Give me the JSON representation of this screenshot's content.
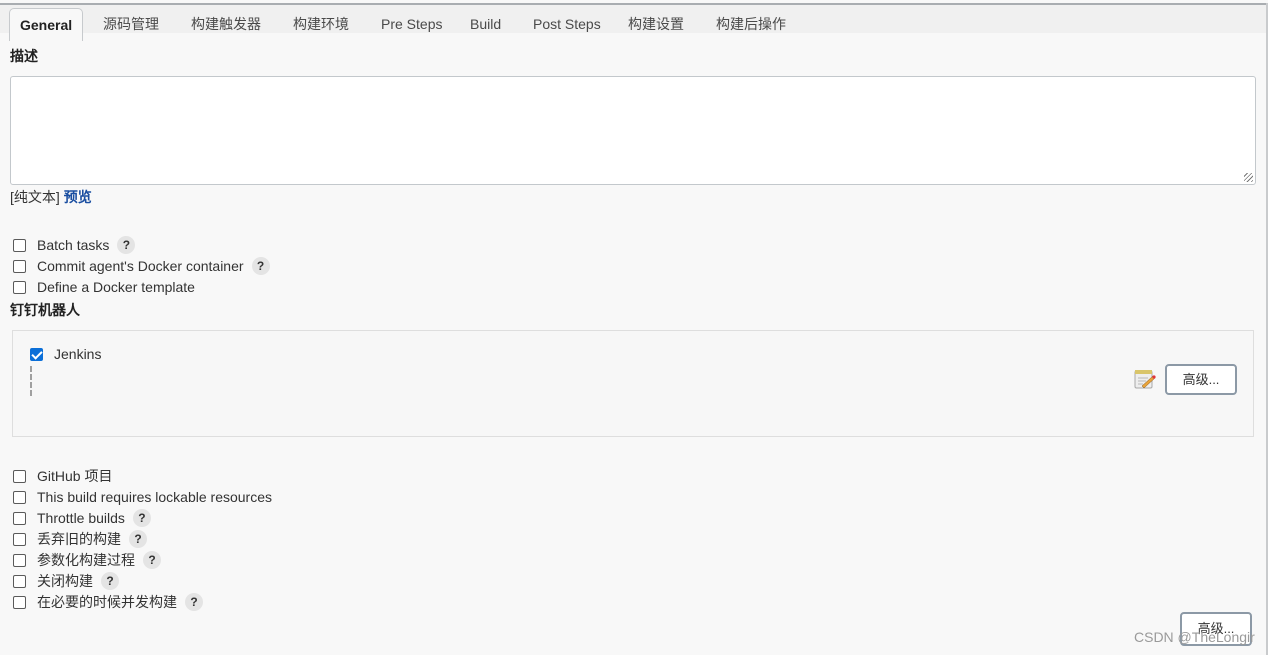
{
  "tabs": [
    {
      "label": "General",
      "active": true
    },
    {
      "label": "源码管理",
      "active": false
    },
    {
      "label": "构建触发器",
      "active": false
    },
    {
      "label": "构建环境",
      "active": false
    },
    {
      "label": "Pre Steps",
      "active": false
    },
    {
      "label": "Build",
      "active": false
    },
    {
      "label": "Post Steps",
      "active": false
    },
    {
      "label": "构建设置",
      "active": false
    },
    {
      "label": "构建后操作",
      "active": false
    }
  ],
  "description": {
    "label": "描述",
    "value": "",
    "format_label": "[纯文本]",
    "preview_link": "预览"
  },
  "options_top": [
    {
      "label": "Batch tasks",
      "checked": false,
      "help": "?"
    },
    {
      "label": "Commit agent's Docker container",
      "checked": false,
      "help": "?"
    },
    {
      "label": "Define a Docker template",
      "checked": false
    }
  ],
  "dingtalk": {
    "section_label": "钉钉机器人",
    "robot_label": "Jenkins",
    "robot_checked": true,
    "advanced_button": "高级..."
  },
  "options_bottom": [
    {
      "label": "GitHub 项目",
      "checked": false
    },
    {
      "label": "This build requires lockable resources",
      "checked": false
    },
    {
      "label": "Throttle builds",
      "checked": false,
      "help": "?"
    },
    {
      "label": "丢弃旧的构建",
      "checked": false,
      "help": "?"
    },
    {
      "label": "参数化构建过程",
      "checked": false,
      "help": "?"
    },
    {
      "label": "关闭构建",
      "checked": false,
      "help": "?"
    },
    {
      "label": "在必要的时候并发构建",
      "checked": false,
      "help": "?"
    }
  ],
  "advanced_button_bottom": "高级...",
  "watermark": "CSDN @TheLongir"
}
